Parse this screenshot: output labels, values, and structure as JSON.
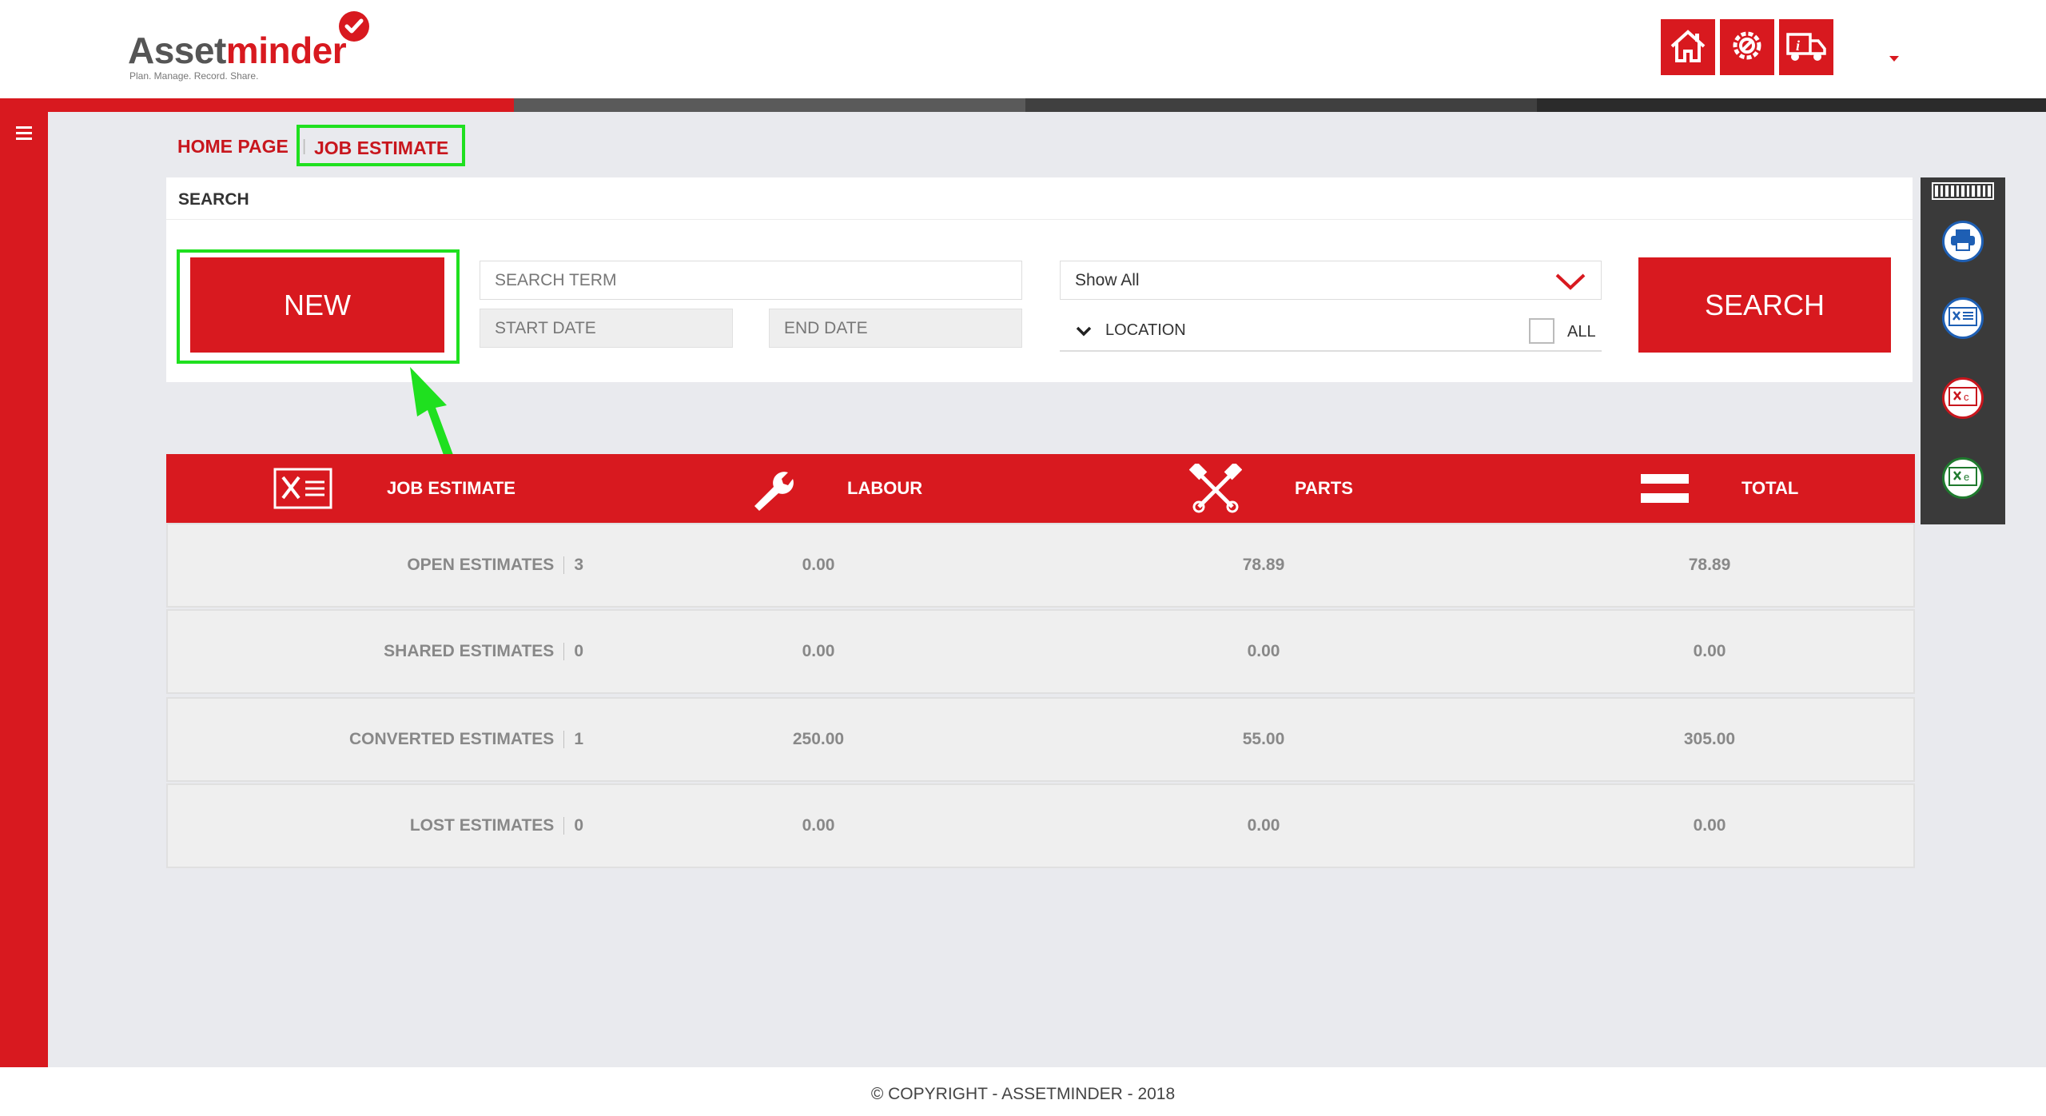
{
  "brand": {
    "name_part1": "Asset",
    "name_part2": "minder",
    "tagline": "Plan. Manage. Record. Share.",
    "accent_color": "#d8191f",
    "highlight_color": "#1fe01f"
  },
  "header": {
    "icons": [
      "home-icon",
      "service-gear-icon",
      "truck-info-icon"
    ]
  },
  "breadcrumb": {
    "home": "HOME PAGE",
    "current": "JOB ESTIMATE"
  },
  "search": {
    "title": "SEARCH",
    "new_label": "NEW",
    "term_placeholder": "SEARCH TERM",
    "start_date_placeholder": "START DATE",
    "end_date_placeholder": "END DATE",
    "status_selected": "Show All",
    "location_label": "LOCATION",
    "all_label": "ALL",
    "search_label": "SEARCH"
  },
  "table": {
    "headers": {
      "job_estimate": "JOB ESTIMATE",
      "labour": "LABOUR",
      "parts": "PARTS",
      "total": "TOTAL"
    },
    "rows": [
      {
        "label": "OPEN ESTIMATES",
        "count": "3",
        "labour": "0.00",
        "parts": "78.89",
        "total": "78.89"
      },
      {
        "label": "SHARED ESTIMATES",
        "count": "0",
        "labour": "0.00",
        "parts": "0.00",
        "total": "0.00"
      },
      {
        "label": "CONVERTED ESTIMATES",
        "count": "1",
        "labour": "250.00",
        "parts": "55.00",
        "total": "305.00"
      },
      {
        "label": "LOST ESTIMATES",
        "count": "0",
        "labour": "0.00",
        "parts": "0.00",
        "total": "0.00"
      }
    ]
  },
  "tools": [
    "barcode-icon",
    "print-icon",
    "export-estimate-icon",
    "export-csv-icon",
    "export-excel-icon"
  ],
  "footer": {
    "copyright": "© COPYRIGHT - ASSETMINDER - 2018"
  }
}
